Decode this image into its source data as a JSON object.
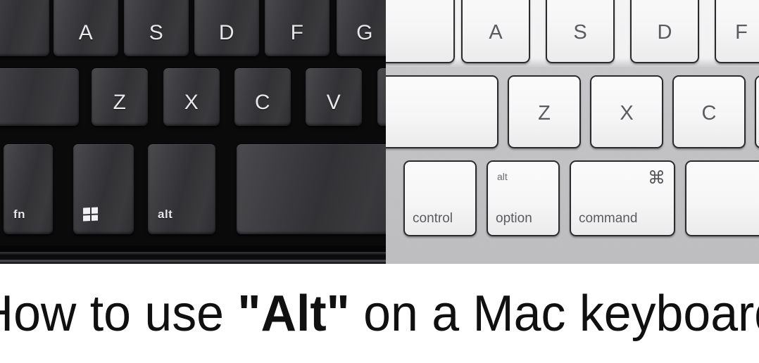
{
  "caption": {
    "prefix": "How to use ",
    "highlight": "\"Alt\"",
    "suffix": " on a Mac keyboard",
    "full": "How to use \"Alt\" on a Mac keyboard"
  },
  "colors": {
    "page_background": "#ffffff",
    "caption_text": "#101010",
    "windows_chassis": "#0a0a0b",
    "windows_keycap": "#3a3a3d",
    "windows_legend": "#e8e8ea",
    "mac_chassis": "#c4c4c6",
    "mac_keycap": "#f6f6f7",
    "mac_legend": "#5b5b5f"
  },
  "windows_keyboard": {
    "name": "windows-keyboard-photo",
    "rows": [
      {
        "name": "home-row",
        "keys": [
          {
            "label": "",
            "name": "caps-lock-key"
          },
          {
            "label": "A",
            "name": "a-key"
          },
          {
            "label": "S",
            "name": "s-key"
          },
          {
            "label": "D",
            "name": "d-key"
          },
          {
            "label": "F",
            "name": "f-key"
          },
          {
            "label": "G",
            "name": "g-key"
          }
        ]
      },
      {
        "name": "bottom-letter-row",
        "keys": [
          {
            "label": "",
            "name": "left-shift-key"
          },
          {
            "label": "Z",
            "name": "z-key"
          },
          {
            "label": "X",
            "name": "x-key"
          },
          {
            "label": "C",
            "name": "c-key"
          },
          {
            "label": "V",
            "name": "v-key"
          }
        ]
      },
      {
        "name": "modifier-row",
        "keys": [
          {
            "label": "fn",
            "name": "fn-key"
          },
          {
            "label": "",
            "icon": "windows-logo-icon",
            "name": "windows-logo-key"
          },
          {
            "label": "alt",
            "name": "alt-key"
          },
          {
            "label": "",
            "name": "space-bar-key"
          }
        ]
      }
    ]
  },
  "mac_keyboard": {
    "name": "mac-keyboard-photo",
    "rows": [
      {
        "name": "home-row",
        "keys": [
          {
            "label": "",
            "name": "caps-lock-key"
          },
          {
            "label": "A",
            "name": "a-key"
          },
          {
            "label": "S",
            "name": "s-key"
          },
          {
            "label": "D",
            "name": "d-key"
          },
          {
            "label": "F",
            "name": "f-key"
          }
        ]
      },
      {
        "name": "bottom-letter-row",
        "keys": [
          {
            "label": "",
            "name": "left-shift-key"
          },
          {
            "label": "Z",
            "name": "z-key"
          },
          {
            "label": "X",
            "name": "x-key"
          },
          {
            "label": "C",
            "name": "c-key"
          }
        ]
      },
      {
        "name": "modifier-row",
        "keys": [
          {
            "label": "control",
            "name": "control-key"
          },
          {
            "label": "option",
            "sublabel": "alt",
            "name": "option-key"
          },
          {
            "label": "command",
            "glyph": "⌘",
            "name": "command-key"
          },
          {
            "label": "",
            "name": "space-bar-key"
          }
        ]
      }
    ]
  }
}
